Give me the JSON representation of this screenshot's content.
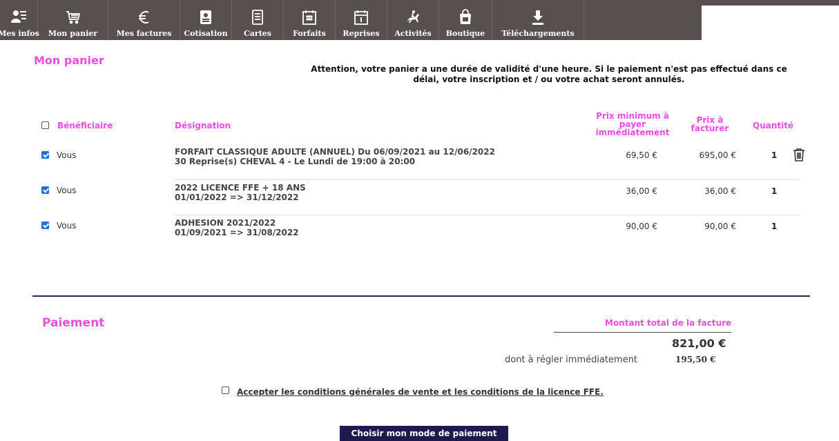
{
  "nav": {
    "items": [
      {
        "label": "Mes infos",
        "icon": "user-card-icon"
      },
      {
        "label": "Mon panier",
        "icon": "cart-icon"
      },
      {
        "label": "Mes factures",
        "icon": "euro-icon"
      },
      {
        "label": "Cotisation",
        "icon": "id-badge-icon"
      },
      {
        "label": "Cartes",
        "icon": "card-list-icon"
      },
      {
        "label": "Forfaits",
        "icon": "calendar-grid-icon"
      },
      {
        "label": "Reprises",
        "icon": "calendar-day-icon"
      },
      {
        "label": "Activités",
        "icon": "horse-rider-icon"
      },
      {
        "label": "Boutique",
        "icon": "shopping-bag-icon"
      },
      {
        "label": "Téléchargements",
        "icon": "download-icon"
      }
    ]
  },
  "cart": {
    "title": "Mon panier",
    "notice_line1": "Attention, votre panier a une durée de validité d'une heure. Si le paiement n'est pas effectué dans ce",
    "notice_line2": "délai, votre inscription et / ou votre achat seront annulés.",
    "headers": {
      "beneficiary": "Bénéficiaire",
      "designation": "Désignation",
      "min_price_1": "Prix minimum à",
      "min_price_2": "payer",
      "min_price_3": "immédiatement",
      "invoice_price_1": "Prix à",
      "invoice_price_2": "facturer",
      "quantity": "Quantité"
    },
    "select_all_checked": false,
    "rows": [
      {
        "checked": true,
        "beneficiary": "Vous",
        "designation_line1": "FORFAIT CLASSIQUE ADULTE (ANNUEL) Du 06/09/2021 au 12/06/2022",
        "designation_line2": "30 Reprise(s) CHEVAL 4 - Le Lundi de 19:00 à 20:00",
        "min_price": "69,50 €",
        "invoice_price": "695,00 €",
        "quantity": "1",
        "deletable": true
      },
      {
        "checked": true,
        "beneficiary": "Vous",
        "designation_line1": "2022 LICENCE FFE + 18 ANS",
        "designation_line2": "01/01/2022 => 31/12/2022",
        "min_price": "36,00 €",
        "invoice_price": "36,00 €",
        "quantity": "1",
        "deletable": false
      },
      {
        "checked": true,
        "beneficiary": "Vous",
        "designation_line1": "ADHESION 2021/2022",
        "designation_line2": "01/09/2021 => 31/08/2022",
        "min_price": "90,00 €",
        "invoice_price": "90,00 €",
        "quantity": "1",
        "deletable": false
      }
    ]
  },
  "payment": {
    "title": "Paiement",
    "total_label": "Montant total de la facture",
    "total_value": "821,00 €",
    "immediate_label": "dont à régler immédiatement",
    "immediate_value": "195,50 €",
    "accept_label": "Accepter les conditions générales de vente et les conditions de la licence FFE.",
    "accept_checked": false,
    "choose_button": "Choisir mon mode de paiement"
  },
  "colors": {
    "nav_bg": "#57504f",
    "accent_pink": "#e84ee0",
    "divider": "#2a2550",
    "button_bg": "#1d1a4d",
    "checkbox_blue": "#1e6fd9"
  }
}
